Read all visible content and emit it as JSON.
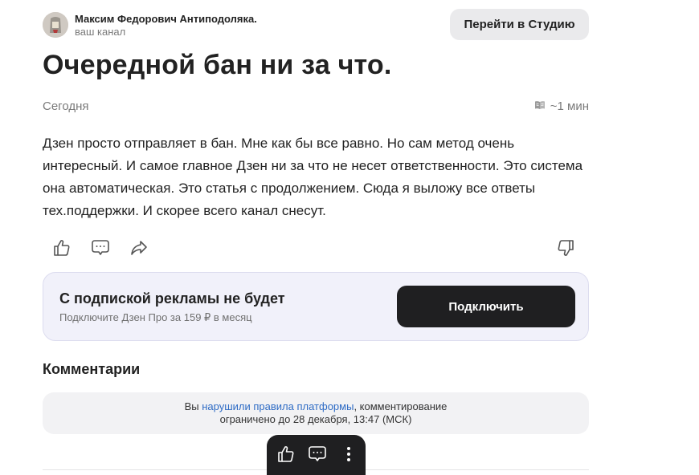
{
  "author": {
    "name": "Максим Федорович Антиподоляка.",
    "subtitle": "ваш канал"
  },
  "header": {
    "studio_button": "Перейти в Студию"
  },
  "article": {
    "title": "Очередной бан ни за что.",
    "date": "Сегодня",
    "read_time": "~1 мин",
    "body": "Дзен просто отправляет в бан. Мне как бы все равно. Но сам метод очень интересный. И самое главное Дзен ни за что не несет ответственности. Это система она автоматическая. Это статья с продолжением. Сюда я выложу все ответы тех.поддержки. И скорее всего канал снесут."
  },
  "actions": {
    "icons": [
      "thumbs-up-icon",
      "comment-icon",
      "share-icon",
      "thumbs-down-icon"
    ]
  },
  "promo": {
    "title": "С подпиской рекламы не будет",
    "subtitle": "Подключите Дзен Про за 159 ₽ в месяц",
    "button": "Подключить"
  },
  "comments": {
    "heading": "Комментарии",
    "notice_prefix": "Вы ",
    "notice_link": "нарушили правила платформы",
    "notice_suffix": ", комментирование",
    "notice_line2": "ограничено до 28 декабря, 13:47 (МСК)"
  },
  "floating_bar": {
    "icons": [
      "thumbs-up-icon",
      "comment-icon",
      "more-vertical-icon"
    ]
  },
  "colors": {
    "link": "#2f6cc5",
    "promo_bg": "#f1f1fa",
    "dark_button": "#1f1f21"
  }
}
